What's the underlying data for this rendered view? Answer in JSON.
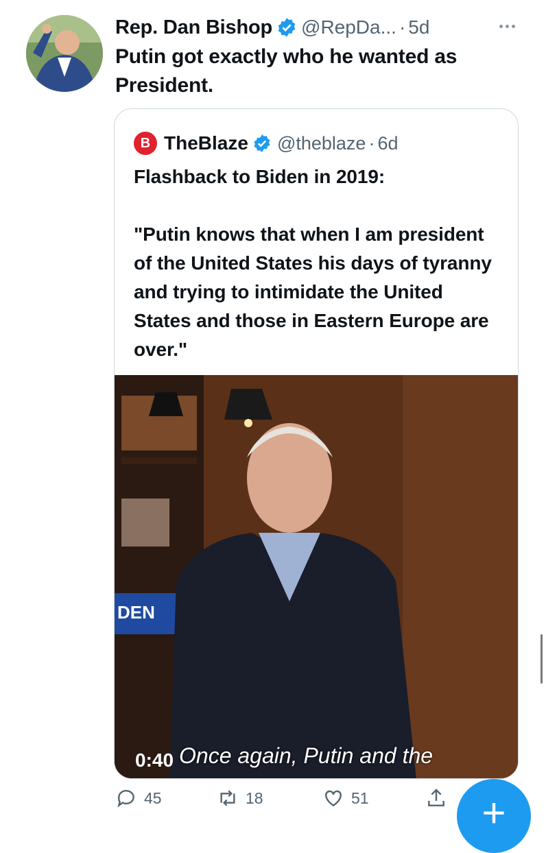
{
  "tweet": {
    "author_name": "Rep. Dan Bishop",
    "handle": "@RepDa...",
    "separator": "·",
    "time": "5d",
    "text": "Putin got exactly who he wanted as President."
  },
  "quoted_tweet": {
    "author_name": "TheBlaze",
    "handle": "@theblaze",
    "separator": "·",
    "time": "6d",
    "text": "Flashback to Biden in 2019:\n\n\"Putin knows that when I am president of the United States his days of tyranny and trying to intimidate the United States and those in Eastern Europe are over.\"",
    "logo_letter": "B"
  },
  "video": {
    "duration": "0:40",
    "caption": "Once again, Putin and the",
    "background_sign": "DEN"
  },
  "actions": {
    "reply_count": "45",
    "retweet_count": "18",
    "like_count": "51"
  },
  "fab": {
    "label": "+"
  },
  "colors": {
    "accent": "#1d9bf0",
    "blaze_red": "#e0212e",
    "muted": "#536471"
  },
  "icons": [
    "verified-badge-icon",
    "more-icon",
    "reply-icon",
    "retweet-icon",
    "like-icon",
    "share-icon",
    "compose-icon"
  ]
}
